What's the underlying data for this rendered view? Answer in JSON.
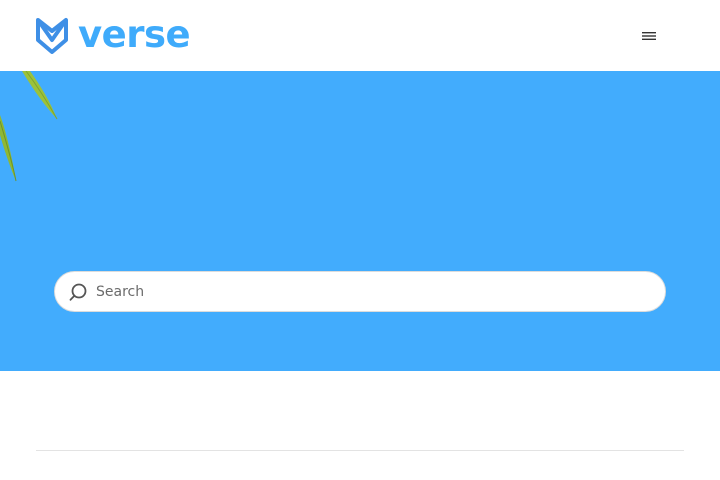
{
  "header": {
    "logo_text": "verse",
    "menu_icon": "hamburger-menu-icon"
  },
  "hero": {
    "decoration_icon": "leaves-icon"
  },
  "search": {
    "placeholder": "Search",
    "value": "",
    "icon": "search-icon"
  },
  "colors": {
    "brand": "#3fabfb",
    "hero_background": "#42acfd",
    "logo_mark": "#3e8fe6",
    "leaf_green": "#9cc23a"
  }
}
